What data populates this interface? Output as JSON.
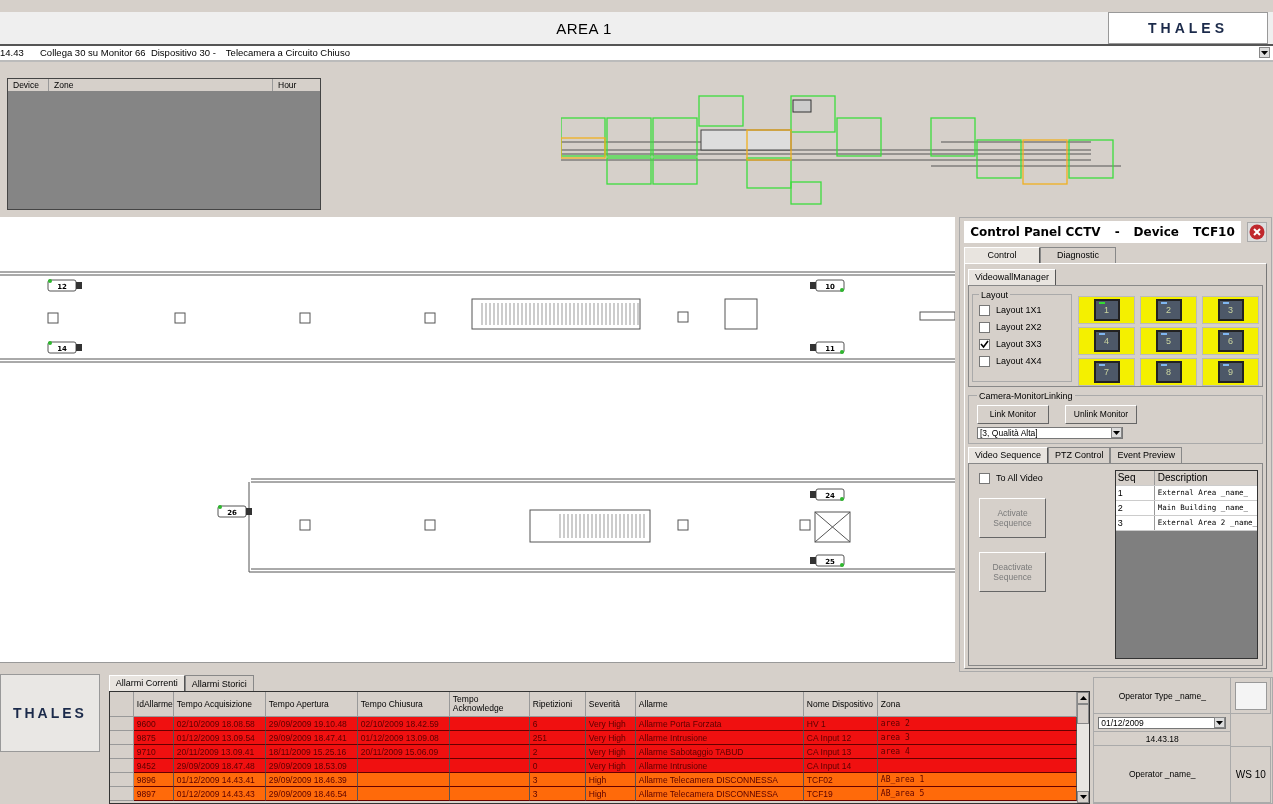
{
  "header": {
    "title": "AREA 1",
    "logo": "THALES"
  },
  "status_line": {
    "time": "14.43",
    "message": "Collega 30 su Monitor 66  Dispositivo 30 -",
    "device": "Telecamera a Circuito Chiuso"
  },
  "device_list": {
    "columns": [
      "Device",
      "Zone",
      "Hour"
    ]
  },
  "floor_plan": {
    "cameras": [
      {
        "label": "12"
      },
      {
        "label": "14"
      },
      {
        "label": "10"
      },
      {
        "label": "11"
      },
      {
        "label": "26"
      },
      {
        "label": "24"
      },
      {
        "label": "25"
      }
    ]
  },
  "control_panel": {
    "title": "Control Panel CCTV",
    "separator": "-",
    "device_label": "Device",
    "device": "TCF10",
    "tabs": [
      {
        "label": "Control",
        "selected": true
      },
      {
        "label": "Diagnostic",
        "selected": false
      }
    ],
    "subtabs": [
      {
        "label": "VideowallManager",
        "selected": true
      }
    ],
    "layout_group": "Layout",
    "layouts": [
      {
        "label": "Layout 1X1",
        "checked": false
      },
      {
        "label": "Layout 2X2",
        "checked": false
      },
      {
        "label": "Layout 3X3",
        "checked": true
      },
      {
        "label": "Layout 4X4",
        "checked": false
      }
    ],
    "monitors": [
      {
        "label": "1",
        "active": true
      },
      {
        "label": "2",
        "active": false
      },
      {
        "label": "3",
        "active": false
      },
      {
        "label": "4",
        "active": false
      },
      {
        "label": "5",
        "active": false
      },
      {
        "label": "6",
        "active": false
      },
      {
        "label": "7",
        "active": false
      },
      {
        "label": "8",
        "active": false
      },
      {
        "label": "9",
        "active": false
      }
    ],
    "linking_group": "Camera-MonitorLinking",
    "link_button": "Link Monitor",
    "unlink_button": "Unlink Monitor",
    "quality": "[3, Qualità Alta]",
    "seq_tabs": [
      {
        "label": "Video Sequence",
        "selected": true
      },
      {
        "label": "PTZ Control",
        "selected": false
      },
      {
        "label": "Event Preview",
        "selected": false
      }
    ],
    "to_all_video": {
      "label": "To All Video",
      "checked": false
    },
    "activate_button": {
      "label": "Activate Sequence",
      "disabled": true
    },
    "deactivate_button": {
      "label": "Deactivate Sequence",
      "disabled": true
    },
    "sequence_table": {
      "columns": [
        "Seq",
        "Description"
      ],
      "rows": [
        {
          "seq": "1",
          "description": "External Area _name_"
        },
        {
          "seq": "2",
          "description": "Main Building _name_"
        },
        {
          "seq": "3",
          "description": "External Area 2 _name_"
        }
      ]
    }
  },
  "bottom_logo": "THALES",
  "alarm_tabs": [
    {
      "label": "Allarmi Correnti",
      "selected": true
    },
    {
      "label": "Allarmi Storici",
      "selected": false
    }
  ],
  "alarms": {
    "columns": [
      "IdAllarme",
      "Tempo Acquisizione",
      "Tempo Apertura",
      "Tempo Chiusura",
      "Tempo Acknowledge",
      "Ripetizioni",
      "Severità",
      "Allarme",
      "Nome Dispositivo",
      "Zona"
    ],
    "rows": [
      {
        "color": "#f01010",
        "cells": [
          "9600",
          "02/10/2009 18.08.58",
          "29/09/2009 19.10.48",
          "02/10/2009 18.42.59",
          "",
          "6",
          "Very High",
          "Allarme Porta Forzata",
          "HV 1",
          "area 2"
        ]
      },
      {
        "color": "#f01010",
        "cells": [
          "9875",
          "01/12/2009 13.09.54",
          "29/09/2009 18.47.41",
          "01/12/2009 13.09.08",
          "",
          "251",
          "Very High",
          "Allarme Intrusione",
          "CA Input 12",
          "area 3"
        ]
      },
      {
        "color": "#f01010",
        "cells": [
          "9710",
          "20/11/2009 13.09.41",
          "18/11/2009 15.25.16",
          "20/11/2009 15.06.09",
          "",
          "2",
          "Very High",
          "Allarme Sabotaggio TABUD",
          "CA Input 13",
          "area 4"
        ]
      },
      {
        "color": "#f01010",
        "cells": [
          "9452",
          "29/09/2009 18.47.48",
          "29/09/2009 18.53.09",
          "",
          "",
          "0",
          "Very High",
          "Allarme Intrusione",
          "CA Input 14",
          ""
        ]
      },
      {
        "color": "#ff6a0a",
        "cells": [
          "9896",
          "01/12/2009 14.43.41",
          "29/09/2009 18.46.39",
          "",
          "",
          "3",
          "High",
          "Allarme Telecamera DISCONNESSA",
          "TCF02",
          "AB_area 1"
        ]
      },
      {
        "color": "#ff6a0a",
        "cells": [
          "9897",
          "01/12/2009 14.43.43",
          "29/09/2009 18.46.54",
          "",
          "",
          "3",
          "High",
          "Allarme Telecamera DISCONNESSA",
          "TCF19",
          "AB_area 5"
        ]
      }
    ]
  },
  "operator_panel": {
    "operator_type": "Operator Type _name_",
    "date": "01/12/2009",
    "time": "14.43.18",
    "operator": "Operator _name_",
    "workstation": "WS 10"
  }
}
